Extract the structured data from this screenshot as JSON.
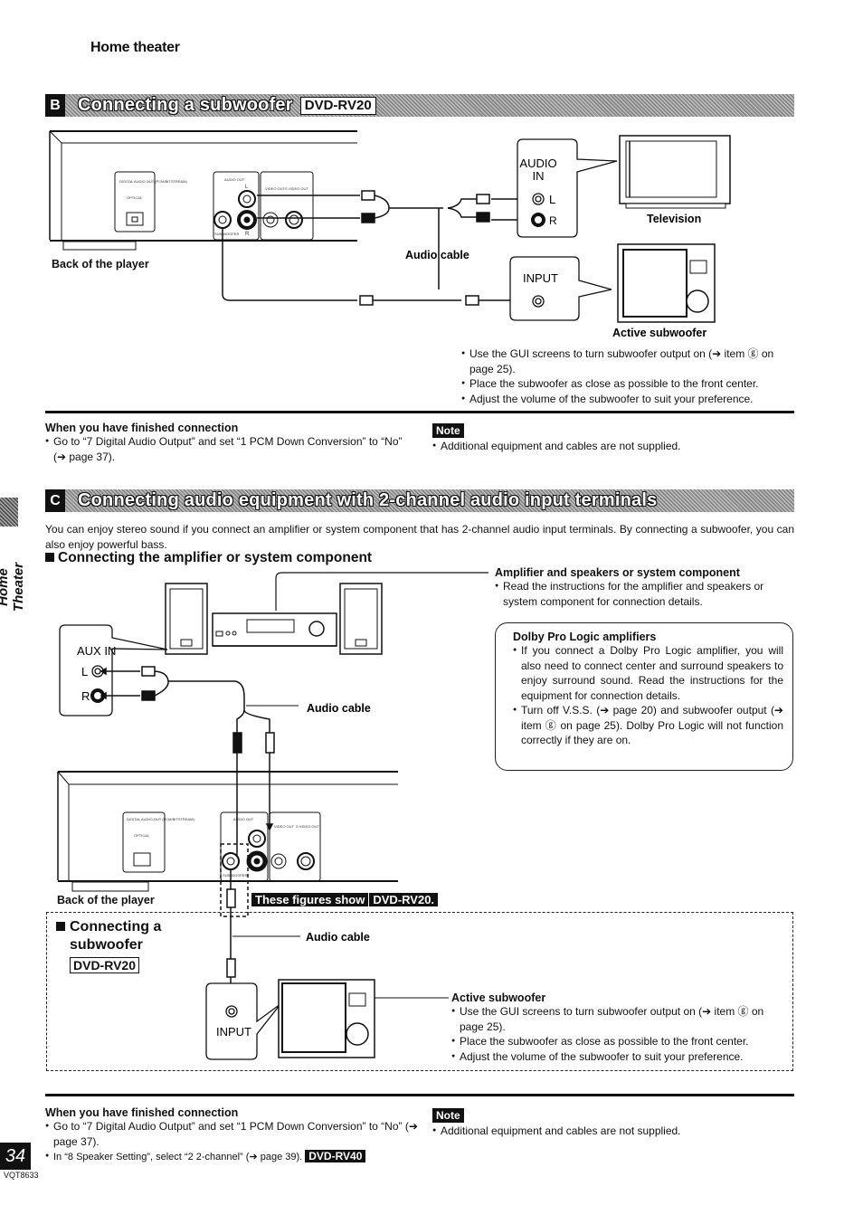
{
  "running_head": "Home theater",
  "side_tab_label": "Home Theater",
  "page_number": "34",
  "doc_code": "VQT8633",
  "section_b": {
    "letter": "B",
    "title": "Connecting a subwoofer",
    "model_tag": "DVD-RV20",
    "diagram": {
      "player_label": "Back of the player",
      "panel_labels": {
        "digital_out": "DIGITAL AUDIO OUT (PCM/BITSTREAM)",
        "optical": "OPTICAL",
        "audio_out": "AUDIO OUT",
        "subwoofer": "SUB WOOFER",
        "video_out": "VIDEO OUT",
        "s_video_out": "S VIDEO OUT",
        "left": "L",
        "right": "R"
      },
      "audio_cable_label": "Audio cable",
      "tv_callout": {
        "line1": "AUDIO",
        "line2": "IN",
        "left": "L",
        "right": "R"
      },
      "tv_label": "Television",
      "sub_callout": "INPUT",
      "sub_label": "Active subwoofer"
    },
    "subwoofer_notes": [
      "Use the GUI screens to turn subwoofer output on (➔ item ⓖ on page 25).",
      "Place the subwoofer as close as possible to the front center.",
      "Adjust the volume of the subwoofer to suit your preference."
    ],
    "finished": {
      "heading": "When you have finished connection",
      "items": [
        "Go to “7 Digital Audio Output” and set “1 PCM Down Conversion” to “No” (➔ page 37)."
      ]
    },
    "note": {
      "badge": "Note",
      "items": [
        "Additional equipment and cables are not supplied."
      ]
    }
  },
  "section_c": {
    "letter": "C",
    "title": "Connecting audio equipment with 2-channel audio input terminals",
    "intro": "You can enjoy stereo sound if you connect an amplifier or system component that has 2-channel audio input terminals. By connecting a subwoofer, you can also enjoy powerful bass.",
    "subheading": "Connecting the amplifier or system component",
    "amp_heading": "Amplifier and speakers or system component",
    "amp_items": [
      "Read the instructions for the amplifier and speakers or system component for connection details."
    ],
    "dolby_box": {
      "heading": "Dolby Pro Logic amplifiers",
      "items": [
        "If you connect a Dolby Pro Logic amplifier, you will also need to connect center and surround speakers to enjoy surround sound. Read the instructions for the equipment for connection details.",
        "Turn off V.S.S. (➔ page 20) and subwoofer output (➔ item ⓖ on page 25). Dolby Pro Logic will not function correctly if they are on."
      ]
    },
    "diagram": {
      "aux_callout": {
        "title": "AUX IN",
        "left": "L",
        "right": "R"
      },
      "audio_cable_label": "Audio cable",
      "player_label": "Back of the player",
      "figures_note": "These figures show",
      "figures_model": "DVD-RV20."
    },
    "subwoofer_sub": {
      "heading_line1": "Connecting a",
      "heading_line2": "subwoofer",
      "model_tag": "DVD-RV20",
      "audio_cable_label": "Audio cable",
      "input_label": "INPUT",
      "active_label": "Active subwoofer",
      "items": [
        "Use the GUI screens to turn subwoofer output on (➔ item ⓖ on page 25).",
        "Place the subwoofer as close as possible to the front center.",
        "Adjust the volume of the subwoofer to suit your preference."
      ]
    },
    "finished": {
      "heading": "When you have finished connection",
      "items": [
        "Go to “7 Digital Audio Output” and set “1 PCM Down Conversion” to “No” (➔ page 37).",
        "In “8 Speaker Setting”, select “2 2-channel” (➔ page 39)."
      ],
      "model_tag": "DVD-RV40"
    },
    "note": {
      "badge": "Note",
      "items": [
        "Additional equipment and cables are not supplied."
      ]
    }
  }
}
